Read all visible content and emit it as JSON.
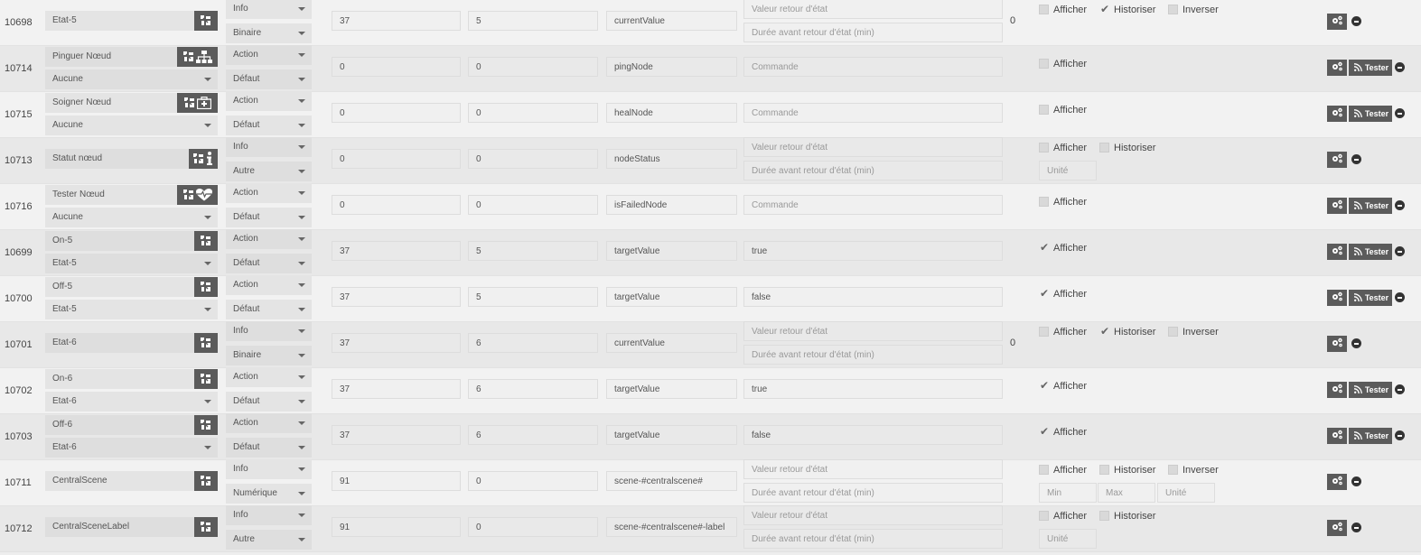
{
  "labels": {
    "afficher": "Afficher",
    "historiser": "Historiser",
    "inverser": "Inverser",
    "tester": "Tester",
    "valeur_retour": "Valeur retour d'état",
    "duree_retour": "Durée avant retour d'état (min)",
    "commande": "Commande",
    "unite": "Unité",
    "min": "Min",
    "max": "Max"
  },
  "rows": [
    {
      "id": "10698",
      "name": "Etat-5",
      "value_cmd": null,
      "type": "Info",
      "subtype": "Binaire",
      "class": "37",
      "instance": "5",
      "cmd": "currentValue",
      "mode": "info",
      "zero": "0",
      "afficher": false,
      "historiser": true,
      "inverser": false,
      "icons": [
        "zwave"
      ]
    },
    {
      "id": "10714",
      "name": "Pinguer Nœud",
      "value_cmd": "Aucune",
      "type": "Action",
      "subtype": "Défaut",
      "class": "0",
      "instance": "0",
      "cmd": "pingNode",
      "mode": "action",
      "afficher": false,
      "icons": [
        "zwave",
        "network"
      ]
    },
    {
      "id": "10715",
      "name": "Soigner Nœud",
      "value_cmd": "Aucune",
      "type": "Action",
      "subtype": "Défaut",
      "class": "0",
      "instance": "0",
      "cmd": "healNode",
      "mode": "action",
      "afficher": false,
      "icons": [
        "zwave",
        "medkit"
      ]
    },
    {
      "id": "10713",
      "name": "Statut nœud",
      "value_cmd": null,
      "type": "Info",
      "subtype": "Autre",
      "class": "0",
      "instance": "0",
      "cmd": "nodeStatus",
      "mode": "info-unit",
      "afficher": false,
      "historiser": false,
      "icons": [
        "zwave",
        "info"
      ]
    },
    {
      "id": "10716",
      "name": "Tester Nœud",
      "value_cmd": "Aucune",
      "type": "Action",
      "subtype": "Défaut",
      "class": "0",
      "instance": "0",
      "cmd": "isFailedNode",
      "mode": "action",
      "afficher": false,
      "icons": [
        "zwave",
        "heartbeat"
      ]
    },
    {
      "id": "10699",
      "name": "On-5",
      "value_cmd": "Etat-5",
      "type": "Action",
      "subtype": "Défaut",
      "class": "37",
      "instance": "5",
      "cmd": "targetValue",
      "value": "true",
      "mode": "action-val",
      "afficher": true,
      "icons": [
        "zwave"
      ]
    },
    {
      "id": "10700",
      "name": "Off-5",
      "value_cmd": "Etat-5",
      "type": "Action",
      "subtype": "Défaut",
      "class": "37",
      "instance": "5",
      "cmd": "targetValue",
      "value": "false",
      "mode": "action-val",
      "afficher": true,
      "icons": [
        "zwave"
      ]
    },
    {
      "id": "10701",
      "name": "Etat-6",
      "value_cmd": null,
      "type": "Info",
      "subtype": "Binaire",
      "class": "37",
      "instance": "6",
      "cmd": "currentValue",
      "mode": "info",
      "zero": "0",
      "afficher": false,
      "historiser": true,
      "inverser": false,
      "icons": [
        "zwave"
      ]
    },
    {
      "id": "10702",
      "name": "On-6",
      "value_cmd": "Etat-6",
      "type": "Action",
      "subtype": "Défaut",
      "class": "37",
      "instance": "6",
      "cmd": "targetValue",
      "value": "true",
      "mode": "action-val",
      "afficher": true,
      "icons": [
        "zwave"
      ]
    },
    {
      "id": "10703",
      "name": "Off-6",
      "value_cmd": "Etat-6",
      "type": "Action",
      "subtype": "Défaut",
      "class": "37",
      "instance": "6",
      "cmd": "targetValue",
      "value": "false",
      "mode": "action-val",
      "afficher": true,
      "icons": [
        "zwave"
      ]
    },
    {
      "id": "10711",
      "name": "CentralScene",
      "value_cmd": null,
      "type": "Info",
      "subtype": "Numérique",
      "class": "91",
      "instance": "0",
      "cmd": "scene-#centralscene#",
      "mode": "info-num",
      "afficher": false,
      "historiser": false,
      "inverser": false,
      "icons": [
        "zwave"
      ]
    },
    {
      "id": "10712",
      "name": "CentralSceneLabel",
      "value_cmd": null,
      "type": "Info",
      "subtype": "Autre",
      "class": "91",
      "instance": "0",
      "cmd": "scene-#centralscene#-label",
      "mode": "info-unit",
      "afficher": false,
      "historiser": false,
      "icons": [
        "zwave"
      ]
    }
  ]
}
